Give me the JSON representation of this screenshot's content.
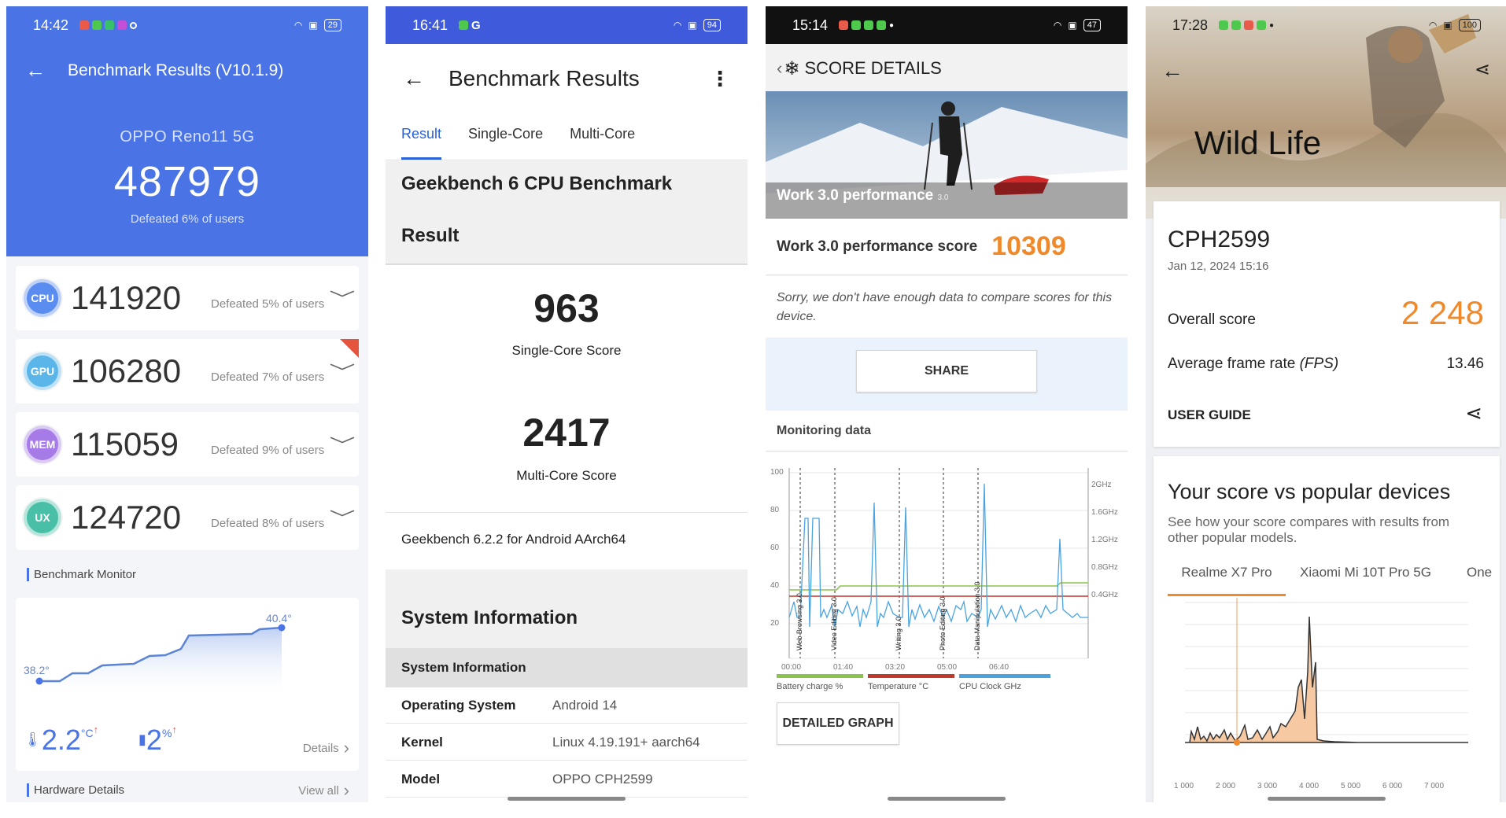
{
  "p1": {
    "status": {
      "time": "14:42",
      "battery": "29"
    },
    "title": "Benchmark Results (V10.1.9)",
    "device": "OPPO Reno11 5G",
    "total": "487979",
    "defeated": "Defeated 6% of users",
    "rows": [
      {
        "badge": "CPU",
        "score": "141920",
        "defeated": "Defeated 5% of users",
        "color": "#5b8cf0"
      },
      {
        "badge": "GPU",
        "score": "106280",
        "defeated": "Defeated 7% of users",
        "color": "#5ab5e8"
      },
      {
        "badge": "MEM",
        "score": "115059",
        "defeated": "Defeated 9% of users",
        "color": "#a67be8"
      },
      {
        "badge": "UX",
        "score": "124720",
        "defeated": "Defeated 8% of users",
        "color": "#48bfa6"
      }
    ],
    "monitor_title": "Benchmark Monitor",
    "temp_start": "38.2°",
    "temp_end": "40.4°",
    "temp_rise": "2.2",
    "temp_unit": "°C",
    "bat_drop": "2",
    "bat_unit": "%",
    "details": "Details",
    "hardware": "Hardware Details",
    "view_all": "View all"
  },
  "p2": {
    "status": {
      "time": "16:41",
      "battery": "94"
    },
    "title": "Benchmark Results",
    "tabs": [
      "Result",
      "Single-Core",
      "Multi-Core"
    ],
    "bench_title": "Geekbench 6 CPU Benchmark",
    "result": "Result",
    "single": "963",
    "single_label": "Single-Core Score",
    "multi": "2417",
    "multi_label": "Multi-Core Score",
    "version": "Geekbench 6.2.2 for Android AArch64",
    "sysinfo": "System Information",
    "sysinfo_sub": "System Information",
    "rows": [
      {
        "k": "Operating System",
        "v": "Android 14"
      },
      {
        "k": "Kernel",
        "v": "Linux 4.19.191+ aarch64"
      },
      {
        "k": "Model",
        "v": "OPPO CPH2599"
      }
    ]
  },
  "p3": {
    "status": {
      "time": "15:14",
      "battery": "47"
    },
    "title": "SCORE DETAILS",
    "banner": "Work 3.0 performance",
    "banner_small": "3.0",
    "score_label": "Work 3.0 performance score",
    "score": "10309",
    "sorry": "Sorry, we don't have enough data to compare scores for this device.",
    "share": "SHARE",
    "monitoring": "Monitoring data",
    "yticks": [
      "100",
      "80",
      "60",
      "40",
      "20"
    ],
    "rticks": [
      "2GHz",
      "1.6GHz",
      "1.2GHz",
      "0.8GHz",
      "0.4GHz"
    ],
    "xticks": [
      "00:00",
      "01:40",
      "03:20",
      "05:00",
      "06:40"
    ],
    "events": [
      "Web Browsing 3.0",
      "Video Editing 3.0",
      "Writing 3.0",
      "Photo Editing 3.0",
      "Data Manipulation 3.0"
    ],
    "legend": [
      {
        "name": "Battery charge %",
        "color": "#8bc34a"
      },
      {
        "name": "Temperature °C",
        "color": "#c0392b"
      },
      {
        "name": "CPU Clock GHz",
        "color": "#4aa3df"
      }
    ],
    "detailed": "DETAILED GRAPH"
  },
  "p4": {
    "status": {
      "time": "17:28",
      "battery": "100"
    },
    "test": "Wild Life",
    "device": "CPH2599",
    "date": "Jan 12, 2024 15:16",
    "overall_label": "Overall score",
    "overall": "2 248",
    "fps_label": "Average frame rate",
    "fps_unit": "(FPS)",
    "fps": "13.46",
    "guide": "USER GUIDE",
    "vs_title": "Your score vs popular devices",
    "vs_sub": "See how your score compares with results from other popular models.",
    "tabs": [
      "Realme X7 Pro",
      "Xiaomi Mi 10T Pro 5G",
      "One"
    ],
    "xticks": [
      "1 000",
      "2 000",
      "3 000",
      "4 000",
      "5 000",
      "6 000",
      "7 000"
    ]
  }
}
